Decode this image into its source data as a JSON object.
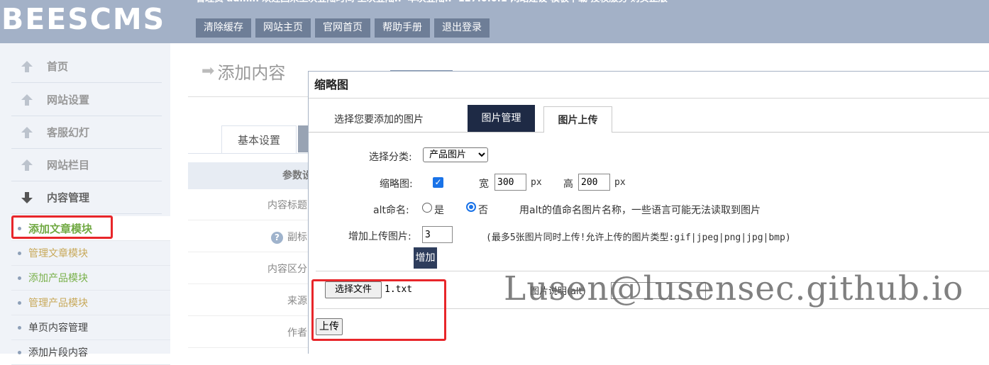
{
  "header": {
    "logo": "BEESCMS",
    "info": "管理员 admin 欢迎回来上次登陆时间 上次登陆IP 本次登陆IP 127.0.0.1 网站建设 模板下载 授权服务 购买正版",
    "buttons": [
      "清除缓存",
      "网站主页",
      "官网首页",
      "帮助手册",
      "退出登录"
    ]
  },
  "sidebar": {
    "menus": [
      {
        "label": "首页",
        "icon": "arrow-up-icon"
      },
      {
        "label": "网站设置",
        "icon": "arrow-up-icon"
      },
      {
        "label": "客服幻灯",
        "icon": "arrow-up-icon"
      },
      {
        "label": "网站栏目",
        "icon": "arrow-up-icon"
      },
      {
        "label": "内容管理",
        "icon": "arrow-down-icon"
      }
    ],
    "subitems": [
      {
        "label": "添加文章模块",
        "color": "#71a943"
      },
      {
        "label": "管理文章模块",
        "color": "#c8a95a"
      },
      {
        "label": "添加产品模块",
        "color": "#79b04a"
      },
      {
        "label": "管理产品模块",
        "color": "#c8a95a"
      },
      {
        "label": "单页内容管理",
        "color": "#444444"
      },
      {
        "label": "添加片段内容",
        "color": "#444444"
      }
    ]
  },
  "main": {
    "page_title": "添加内容",
    "tab_basic": "基本设置",
    "param_header": "参数设",
    "fields": [
      "内容标题",
      "副标",
      "内容区分",
      "来源",
      "作者"
    ]
  },
  "dialog": {
    "title": "缩略图",
    "prompt": "选择您要添加的图片",
    "tab_manage": "图片管理",
    "tab_upload": "图片上传",
    "category_label": "选择分类:",
    "category_value": "产品图片",
    "thumb_label": "缩略图:",
    "width_label": "宽",
    "width_value": "300",
    "height_label": "高",
    "height_value": "200",
    "px": "px",
    "alt_label": "alt命名:",
    "alt_yes": "是",
    "alt_no": "否",
    "alt_hint": "用alt的值命名图片名称，一些语言可能无法读取到图片",
    "more_label": "增加上传图片:",
    "more_value": "3",
    "more_hint": "(最多5张图片同时上传!允许上传的图片类型:gif|jpeg|png|jpg|bmp)",
    "add_button": "增加",
    "choose_file": "选择文件",
    "file_name": "1.txt",
    "alt_desc_label": "图片说明(alt)",
    "upload_button": "上传"
  },
  "watermark": "Lusen@lusensec.github.io",
  "colors": {
    "highlight": "#e8262a",
    "header_bg": "#a3b1c7",
    "accent_dark": "#1e2a45"
  }
}
